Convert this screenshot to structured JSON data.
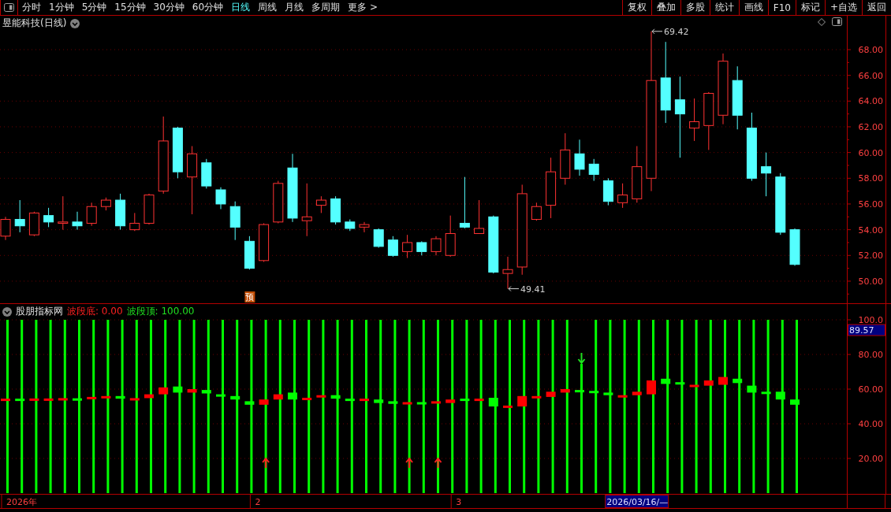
{
  "toolbar": {
    "periods": [
      {
        "label": "分时",
        "selected": false
      },
      {
        "label": "1分钟",
        "selected": false
      },
      {
        "label": "5分钟",
        "selected": false
      },
      {
        "label": "15分钟",
        "selected": false
      },
      {
        "label": "30分钟",
        "selected": false
      },
      {
        "label": "60分钟",
        "selected": false
      },
      {
        "label": "日线",
        "selected": true
      },
      {
        "label": "周线",
        "selected": false
      },
      {
        "label": "月线",
        "selected": false
      },
      {
        "label": "多周期",
        "selected": false
      },
      {
        "label": "更多 >",
        "selected": false
      }
    ],
    "actions": [
      "复权",
      "叠加",
      "多股",
      "统计",
      "画线",
      "F10",
      "标记",
      "+自选",
      "返回"
    ]
  },
  "price_panel": {
    "title": "昱能科技(日线)",
    "y_axis_labels": [
      "68.00",
      "66.00",
      "64.00",
      "62.00",
      "60.00",
      "58.00",
      "56.00",
      "54.00",
      "52.00",
      "50.00"
    ],
    "extremes": [
      {
        "label": "69.42"
      },
      {
        "label": "49.41"
      }
    ],
    "badge": "预"
  },
  "indicator_panel": {
    "title": "股朋指标网",
    "legend": [
      {
        "label": "波段底: 0.00",
        "color": "#ff2020"
      },
      {
        "label": "波段顶: 100.00",
        "color": "#20e020"
      }
    ],
    "y_axis_labels": [
      "100.0",
      "80.00",
      "60.00",
      "40.00",
      "20.00"
    ],
    "current_value": "89.57"
  },
  "time_axis": [
    {
      "label": "2026年",
      "kind": "tick"
    },
    {
      "label": "2",
      "kind": "tick"
    },
    {
      "label": "3",
      "kind": "tick"
    },
    {
      "label": "2026/03/16/—",
      "kind": "cursor"
    }
  ]
}
